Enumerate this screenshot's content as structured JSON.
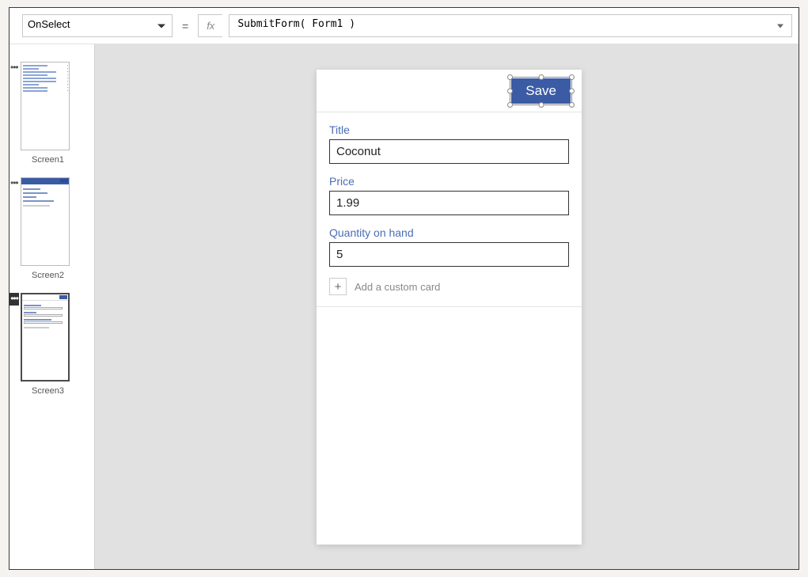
{
  "formula_bar": {
    "property": "OnSelect",
    "equals": "=",
    "fx": "fx",
    "expression": "SubmitForm( Form1 )"
  },
  "screens": [
    {
      "label": "Screen1"
    },
    {
      "label": "Screen2"
    },
    {
      "label": "Screen3"
    }
  ],
  "form": {
    "save_label": "Save",
    "fields": [
      {
        "label": "Title",
        "value": "Coconut"
      },
      {
        "label": "Price",
        "value": "1.99"
      },
      {
        "label": "Quantity on hand",
        "value": "5"
      }
    ],
    "add_card": "Add a custom card",
    "plus": "+"
  }
}
